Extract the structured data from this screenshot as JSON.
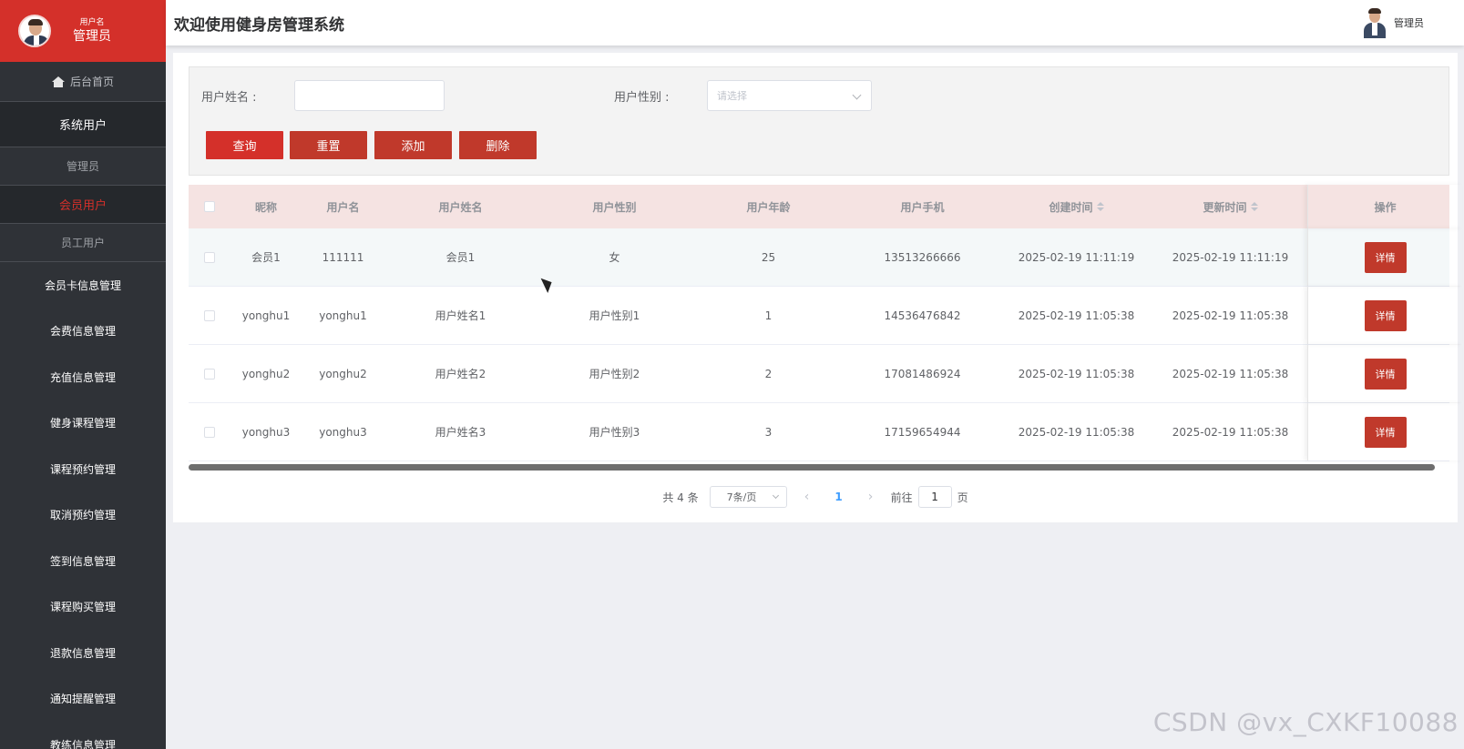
{
  "sidebar": {
    "user_label": "用户名",
    "user_name": "管理员",
    "home": "后台首页",
    "group_system_users": "系统用户",
    "sub_admin": "管理员",
    "sub_member": "会员用户",
    "sub_staff": "员工用户",
    "items": [
      {
        "label": "会员卡信息管理"
      },
      {
        "label": "会费信息管理"
      },
      {
        "label": "充值信息管理"
      },
      {
        "label": "健身课程管理"
      },
      {
        "label": "课程预约管理"
      },
      {
        "label": "取消预约管理"
      },
      {
        "label": "签到信息管理"
      },
      {
        "label": "课程购买管理"
      },
      {
        "label": "退款信息管理"
      },
      {
        "label": "通知提醒管理"
      },
      {
        "label": "教练信息管理"
      }
    ]
  },
  "header": {
    "title": "欢迎使用健身房管理系统",
    "user": "管理员"
  },
  "search": {
    "name_label": "用户姓名 :",
    "name_value": "",
    "gender_label": "用户性别 :",
    "gender_placeholder": "请选择",
    "query_btn": "查询",
    "reset_btn": "重置",
    "add_btn": "添加",
    "delete_btn": "删除"
  },
  "table": {
    "headers": {
      "nickname": "昵称",
      "username": "用户名",
      "realname": "用户姓名",
      "gender": "用户性别",
      "age": "用户年龄",
      "phone": "用户手机",
      "created": "创建时间",
      "updated": "更新时间",
      "action": "操作"
    },
    "detail_label": "详情",
    "rows": [
      {
        "nickname": "会员1",
        "username": "111111",
        "realname": "会员1",
        "gender": "女",
        "age": "25",
        "phone": "13513266666",
        "created": "2025-02-19 11:11:19",
        "updated": "2025-02-19 11:11:19"
      },
      {
        "nickname": "yonghu1",
        "username": "yonghu1",
        "realname": "用户姓名1",
        "gender": "用户性别1",
        "age": "1",
        "phone": "14536476842",
        "created": "2025-02-19 11:05:38",
        "updated": "2025-02-19 11:05:38"
      },
      {
        "nickname": "yonghu2",
        "username": "yonghu2",
        "realname": "用户姓名2",
        "gender": "用户性别2",
        "age": "2",
        "phone": "17081486924",
        "created": "2025-02-19 11:05:38",
        "updated": "2025-02-19 11:05:38"
      },
      {
        "nickname": "yonghu3",
        "username": "yonghu3",
        "realname": "用户姓名3",
        "gender": "用户性别3",
        "age": "3",
        "phone": "17159654944",
        "created": "2025-02-19 11:05:38",
        "updated": "2025-02-19 11:05:38"
      }
    ]
  },
  "pagination": {
    "total": "共 4 条",
    "page_size": "7条/页",
    "prev": "‹",
    "current": "1",
    "next": "›",
    "goto_label": "前往",
    "goto_value": "1",
    "page_suffix": "页"
  },
  "watermark": "CSDN @vx_CXKF10088",
  "colors": {
    "accent": "#d4302a",
    "sidebar_bg": "#2f3237",
    "button": "#c0392b"
  }
}
